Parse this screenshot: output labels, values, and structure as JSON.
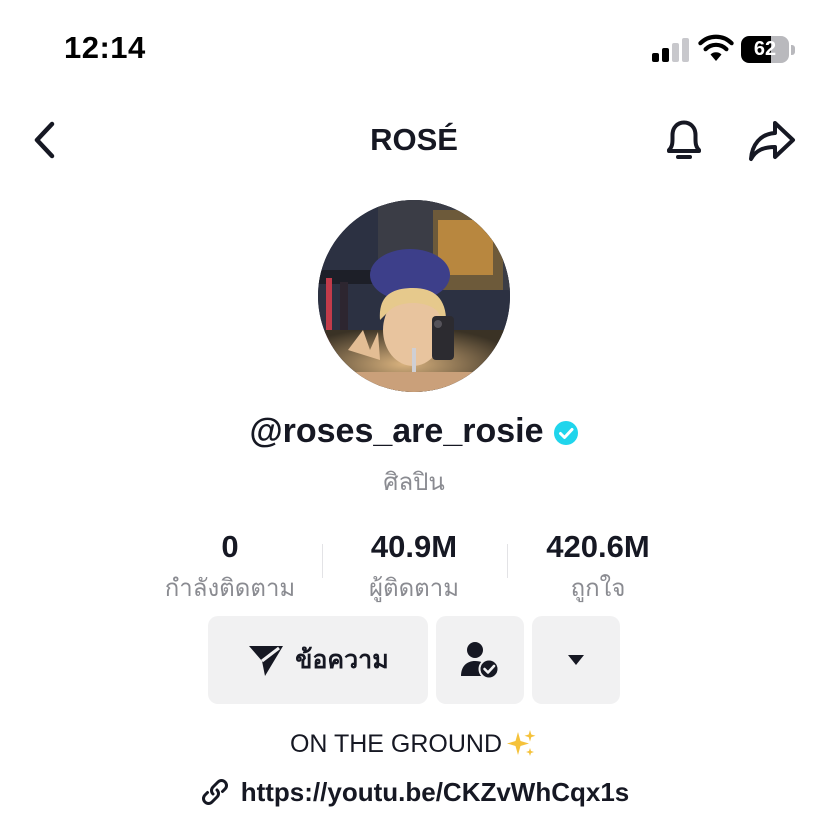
{
  "status_bar": {
    "time": "12:14",
    "battery_level": "62",
    "battery_fraction": 0.62
  },
  "header": {
    "title": "ROSÉ",
    "back_icon": "chevron-left-icon",
    "notify_icon": "bell-icon",
    "share_icon": "share-arrow-icon"
  },
  "profile": {
    "username": "@roses_are_rosie",
    "verified": true,
    "category": "ศิลปิน"
  },
  "stats": [
    {
      "value": "0",
      "label": "กำลังติดตาม"
    },
    {
      "value": "40.9M",
      "label": "ผู้ติดตาม"
    },
    {
      "value": "420.6M",
      "label": "ถูกใจ"
    }
  ],
  "actions": {
    "message_label": "ข้อความ",
    "message_icon": "send-icon",
    "friend_icon": "user-check-icon",
    "more_icon": "caret-down-icon"
  },
  "bio": {
    "text": "ON THE GROUND",
    "emoji": "✨",
    "link": "https://youtu.be/CKZvWhCqx1s"
  },
  "colors": {
    "text_primary": "#161823",
    "text_secondary": "#8a8b91",
    "button_bg": "#f1f1f2",
    "verified_badge": "#20d5ec"
  }
}
